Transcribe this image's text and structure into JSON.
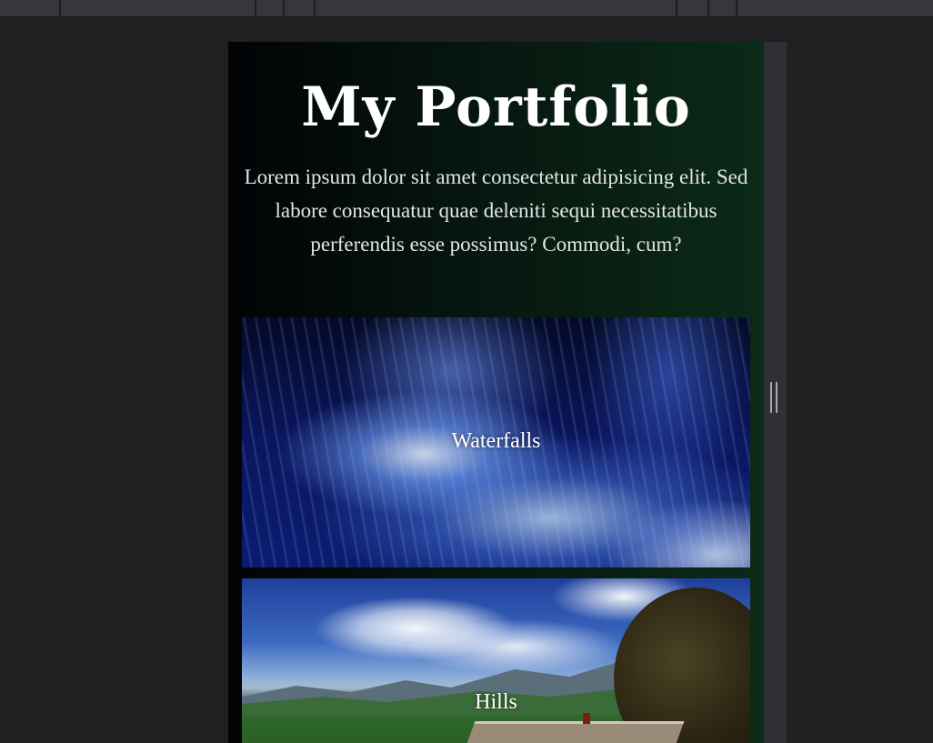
{
  "page": {
    "title": "My Portfolio",
    "intro": "Lorem ipsum dolor sit amet consectetur adipisicing elit. Sed labore consequatur quae deleniti sequi necessitatibus perferendis esse possimus? Commodi, cum?"
  },
  "gallery": {
    "items": [
      {
        "label": "Waterfalls"
      },
      {
        "label": "Hills"
      }
    ]
  },
  "colors": {
    "editor_background": "#202023",
    "toolbar": "#36373b",
    "page_gradient_start": "#010305",
    "page_gradient_end": "#0b2a18",
    "title_text": "#ffffff",
    "intro_text": "#e3e6e5"
  },
  "icons": {
    "resize_handle": "resize-handle-icon"
  }
}
